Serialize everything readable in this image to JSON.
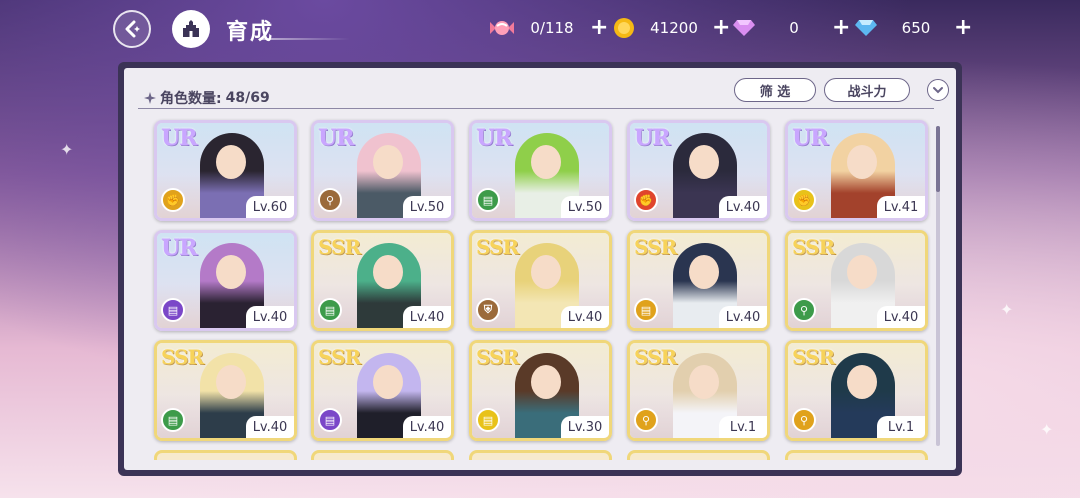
{
  "header": {
    "title": "育成",
    "resources": [
      {
        "icon": "candy-icon",
        "value": "0/118"
      },
      {
        "icon": "gold-coin-icon",
        "value": "41200"
      },
      {
        "icon": "pink-diamond-icon",
        "value": "0"
      },
      {
        "icon": "blue-diamond-icon",
        "value": "650"
      }
    ],
    "plus": "+"
  },
  "panel": {
    "count_label": "角色数量:",
    "count_value": "48/69",
    "filter_label": "筛 选",
    "sort_label": "战斗力"
  },
  "cards": [
    {
      "rarity": "UR",
      "level": "Lv.60",
      "element": "fist",
      "element_color": "#e0a21c",
      "hair": "#2a2530",
      "outfit": "#7b6fb3"
    },
    {
      "rarity": "UR",
      "level": "Lv.50",
      "element": "wand",
      "element_color": "#9b6a3a",
      "hair": "#f0c2cf",
      "outfit": "#4b5a66"
    },
    {
      "rarity": "UR",
      "level": "Lv.50",
      "element": "book",
      "element_color": "#3d9b4a",
      "hair": "#8fcf4a",
      "outfit": "#e8efe6"
    },
    {
      "rarity": "UR",
      "level": "Lv.40",
      "element": "fist",
      "element_color": "#e0452c",
      "hair": "#2b2a3c",
      "outfit": "#3b3552"
    },
    {
      "rarity": "UR",
      "level": "Lv.41",
      "element": "fist",
      "element_color": "#e8c21a",
      "hair": "#f2d2a2",
      "outfit": "#a3422c"
    },
    {
      "rarity": "UR",
      "level": "Lv.40",
      "element": "book",
      "element_color": "#7b47c8",
      "hair": "#b47ac8",
      "outfit": "#2a2232"
    },
    {
      "rarity": "SSR",
      "level": "Lv.40",
      "element": "book",
      "element_color": "#3d9b4a",
      "hair": "#4cb08a",
      "outfit": "#2e3a3a"
    },
    {
      "rarity": "SSR",
      "level": "Lv.40",
      "element": "shield",
      "element_color": "#9b6a3a",
      "hair": "#e8d27a",
      "outfit": "#f3e6b4"
    },
    {
      "rarity": "SSR",
      "level": "Lv.40",
      "element": "book",
      "element_color": "#e0a21c",
      "hair": "#2a3550",
      "outfit": "#e8ecf0"
    },
    {
      "rarity": "SSR",
      "level": "Lv.40",
      "element": "wand",
      "element_color": "#3d9b4a",
      "hair": "#d8d8d8",
      "outfit": "#f0f0f0"
    },
    {
      "rarity": "SSR",
      "level": "Lv.40",
      "element": "book",
      "element_color": "#3d9b4a",
      "hair": "#f2e2a8",
      "outfit": "#2d3d4a"
    },
    {
      "rarity": "SSR",
      "level": "Lv.40",
      "element": "book",
      "element_color": "#7b47c8",
      "hair": "#c3b6ef",
      "outfit": "#1f1f2a"
    },
    {
      "rarity": "SSR",
      "level": "Lv.30",
      "element": "book",
      "element_color": "#e8c21a",
      "hair": "#5a3a28",
      "outfit": "#3a6d7a"
    },
    {
      "rarity": "SSR",
      "level": "Lv.1",
      "element": "wand",
      "element_color": "#e0a21c",
      "hair": "#e2cfae",
      "outfit": "#f4f4f8"
    },
    {
      "rarity": "SSR",
      "level": "Lv.1",
      "element": "wand",
      "element_color": "#e0a21c",
      "hair": "#1f3a4a",
      "outfit": "#243a5a"
    }
  ]
}
